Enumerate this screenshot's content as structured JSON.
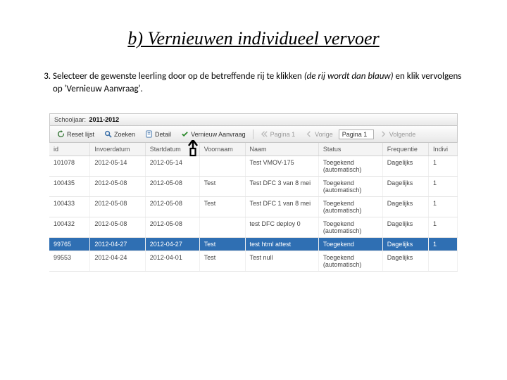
{
  "title": "b) Vernieuwen individueel vervoer",
  "instruction": {
    "number": "3.",
    "text_prefix": "Selecteer de gewenste leerling door op de betreffende rij te klikken ",
    "text_italic": "(de rij wordt dan blauw)",
    "text_suffix": " en klik vervolgens op 'Vernieuw Aanvraag'."
  },
  "schooljaar": {
    "label": "Schooljaar:",
    "value": "2011-2012"
  },
  "toolbar": {
    "reset": "Reset lijst",
    "zoeken": "Zoeken",
    "detail": "Detail",
    "vernieuw": "Vernieuw Aanvraag",
    "pagina_lbl": "Pagina 1",
    "vorige": "Vorige",
    "pagina_box": "Pagina 1",
    "volgende": "Volgende"
  },
  "columns": {
    "id": "id",
    "invoer": "Invoerdatum",
    "start": "Startdatum",
    "voorn": "Voornaam",
    "naam": "Naam",
    "status": "Status",
    "freq": "Frequentie",
    "indiv": "Indivi"
  },
  "rows": [
    {
      "id": "101078",
      "invoer": "2012-05-14",
      "start": "2012-05-14",
      "voorn": "",
      "naam": "Test VMOV-175",
      "status": "Toegekend (automatisch)",
      "freq": "Dagelijks",
      "indiv": "1"
    },
    {
      "id": "100435",
      "invoer": "2012-05-08",
      "start": "2012-05-08",
      "voorn": "Test",
      "naam": "Test DFC 3 van 8 mei",
      "status": "Toegekend (automatisch)",
      "freq": "Dagelijks",
      "indiv": "1"
    },
    {
      "id": "100433",
      "invoer": "2012-05-08",
      "start": "2012-05-08",
      "voorn": "Test",
      "naam": "Test DFC 1 van 8 mei",
      "status": "Toegekend (automatisch)",
      "freq": "Dagelijks",
      "indiv": "1"
    },
    {
      "id": "100432",
      "invoer": "2012-05-08",
      "start": "2012-05-08",
      "voorn": "",
      "naam": "test DFC deploy 0",
      "status": "Toegekend (automatisch)",
      "freq": "Dagelijks",
      "indiv": "1"
    },
    {
      "id": "99765",
      "invoer": "2012-04-27",
      "start": "2012-04-27",
      "voorn": "Test",
      "naam": "test html attest",
      "status": "Toegekend",
      "freq": "Dagelijks",
      "indiv": "1"
    },
    {
      "id": "99553",
      "invoer": "2012-04-24",
      "start": "2012-04-01",
      "voorn": "Test",
      "naam": "Test null",
      "status": "Toegekend (automatisch)",
      "freq": "Dagelijks",
      "indiv": ""
    }
  ],
  "selected_row_index": 4
}
